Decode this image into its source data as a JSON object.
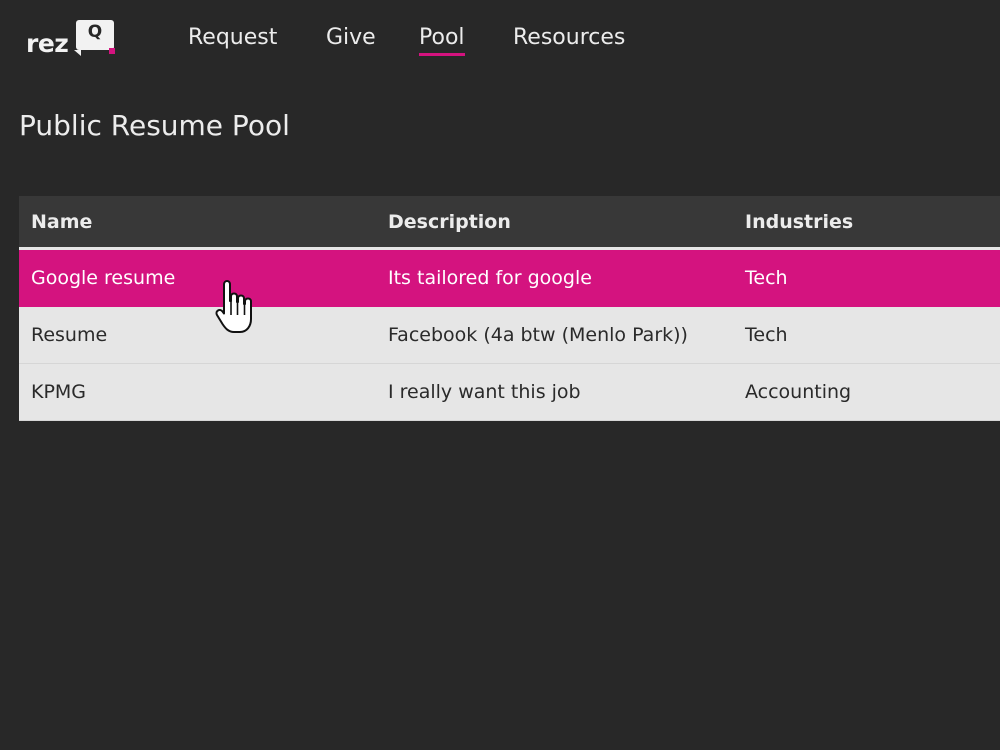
{
  "logo": {
    "text": "rez",
    "badge": "Q",
    "accent_color": "#d4137f"
  },
  "nav": {
    "items": [
      {
        "label": "Request",
        "active": false
      },
      {
        "label": "Give",
        "active": false
      },
      {
        "label": "Pool",
        "active": true
      },
      {
        "label": "Resources",
        "active": false
      }
    ]
  },
  "page": {
    "title": "Public Resume Pool"
  },
  "table": {
    "columns": [
      "Name",
      "Description",
      "Industries"
    ],
    "rows": [
      {
        "name": "Google resume",
        "description": "Its tailored for google",
        "industries": "Tech",
        "highlighted": true
      },
      {
        "name": "Resume",
        "description": "Facebook (4a btw (Menlo Park))",
        "industries": "Tech",
        "highlighted": false
      },
      {
        "name": "KPMG",
        "description": "I really want this job",
        "industries": "Accounting",
        "highlighted": false
      }
    ]
  },
  "colors": {
    "background": "#282828",
    "header_bg": "#383838",
    "row_bg": "#e6e6e6",
    "highlight": "#d4137f"
  },
  "cursor": {
    "icon": "hand-pointer-icon"
  }
}
